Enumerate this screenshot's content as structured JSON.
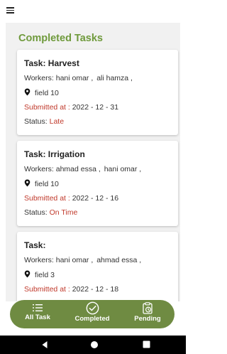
{
  "header": {
    "menu_icon": "hamburger-menu-icon"
  },
  "page": {
    "title": "Completed Tasks"
  },
  "tasks": [
    {
      "title": "Task: Harvest",
      "workers_label": "Workers:",
      "workers": [
        "hani omar ,",
        "ali hamza ,"
      ],
      "field": "field 10",
      "submitted_label": "Submitted at :",
      "submitted_value": "2022 - 12 - 31",
      "status_label": "Status:",
      "status_value": "Late"
    },
    {
      "title": "Task: Irrigation",
      "workers_label": "Workers:",
      "workers": [
        "ahmad essa  ,",
        "hani omar ,"
      ],
      "field": "field 10",
      "submitted_label": "Submitted at :",
      "submitted_value": "2022 - 12 - 16",
      "status_label": "Status:",
      "status_value": "On Time"
    },
    {
      "title": "Task:",
      "workers_label": "Workers:",
      "workers": [
        "hani omar ,",
        "ahmad essa  ,"
      ],
      "field": "field 3",
      "submitted_label": "Submitted at :",
      "submitted_value": "2022 - 12 - 18"
    }
  ],
  "bottom_nav": [
    {
      "label": "All Task",
      "icon": "list-icon"
    },
    {
      "label": "Completed",
      "icon": "check-circle-icon"
    },
    {
      "label": "Pending",
      "icon": "clipboard-clock-icon"
    }
  ],
  "colors": {
    "accent": "#6f9a3c",
    "nav_background": "#6f8b42",
    "late": "#c0392b",
    "submitted_label": "#c0392b"
  }
}
